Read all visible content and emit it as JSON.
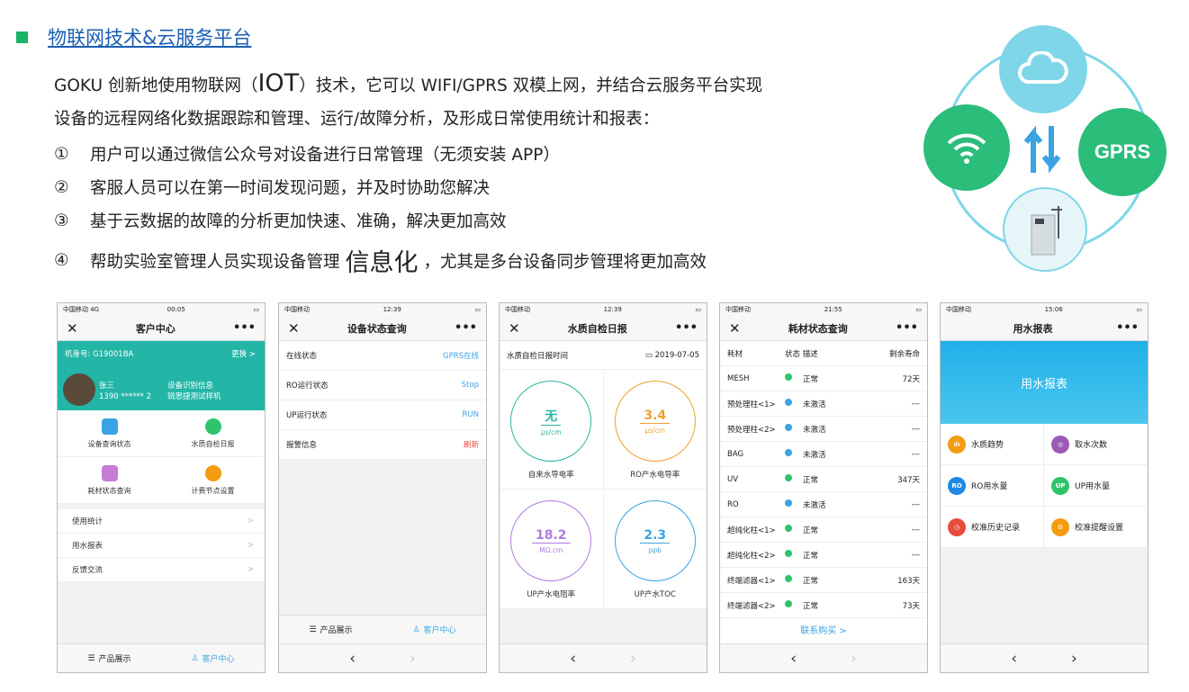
{
  "heading": "物联网技术&云服务平台",
  "intro": {
    "line1a": "GOKU 创新地使用物联网（",
    "iot": "IOT",
    "line1b": "）技术，它可以 WIFI/GPRS 双模上网，并结合云服务平台实现",
    "line2": "设备的远程网络化数据跟踪和管理、运行/故障分析，及形成日常使用统计和报表："
  },
  "items": [
    {
      "num": "①",
      "text": "用户可以通过微信公众号对设备进行日常管理（无须安装 APP）"
    },
    {
      "num": "②",
      "text": "客服人员可以在第一时间发现问题，并及时协助您解决"
    },
    {
      "num": "③",
      "text": "基于云数据的故障的分析更加快速、准确，解决更加高效"
    },
    {
      "num": "④",
      "text_a": "帮助实验室管理人员实现设备管理",
      "big": "信息化",
      "text_b": "，尤其是多台设备同步管理将更加高效"
    }
  ],
  "diagram": {
    "gprs": "GPRS"
  },
  "phone1": {
    "status_left": "中国移动 4G",
    "time": "00:05",
    "title": "客户中心",
    "machine": "机身号: G19001BA",
    "change": "更换 >",
    "name": "张三",
    "phone": "1390 ****** 2",
    "info1": "设备识别信息",
    "info2": "锐思捷测试样机",
    "grid": [
      "设备查询状态",
      "水质自检日报",
      "耗材状态查询",
      "计费节点设置"
    ],
    "list": [
      "使用统计",
      "用水报表",
      "反馈交流"
    ],
    "tab1": "产品展示",
    "tab2": "客户中心"
  },
  "phone2": {
    "status_left": "中国移动",
    "time": "12:39",
    "title": "设备状态查询",
    "rows": [
      {
        "k": "在线状态",
        "v": "GPRS在线"
      },
      {
        "k": "RO运行状态",
        "v": "Stop"
      },
      {
        "k": "UP运行状态",
        "v": "RUN"
      },
      {
        "k": "报警信息",
        "v": "刷新"
      }
    ],
    "tab1": "产品展示",
    "tab2": "客户中心"
  },
  "phone3": {
    "status_left": "中国移动",
    "time": "12:39",
    "title": "水质自检日报",
    "label": "水质自检日报时间",
    "date": "2019-07-05",
    "gauges": [
      {
        "v": "无",
        "u": "μs/cm",
        "l": "自来水导电率",
        "c": "#2bb5a3"
      },
      {
        "v": "3.4",
        "u": "μs/cm",
        "l": "RO产水电导率",
        "c": "#f0a030"
      },
      {
        "v": "18.2",
        "u": "MΩ.cm",
        "l": "UP产水电阻率",
        "c": "#b27be0"
      },
      {
        "v": "2.3",
        "u": "ppb",
        "l": "UP产水TOC",
        "c": "#3aa3e3"
      }
    ]
  },
  "phone4": {
    "status_left": "中国移动",
    "time": "21:55",
    "title": "耗材状态查询",
    "head": {
      "a": "耗材",
      "b": "状态",
      "c": "描述",
      "d": "剩余寿命"
    },
    "rows": [
      {
        "a": "MESH",
        "s": "#2ec46c",
        "c": "正常",
        "d": "72天"
      },
      {
        "a": "预处理柱<1>",
        "s": "#3aa3e3",
        "c": "未激活",
        "d": "---"
      },
      {
        "a": "预处理柱<2>",
        "s": "#3aa3e3",
        "c": "未激活",
        "d": "---"
      },
      {
        "a": "BAG",
        "s": "#3aa3e3",
        "c": "未激活",
        "d": "---"
      },
      {
        "a": "UV",
        "s": "#2ec46c",
        "c": "正常",
        "d": "347天"
      },
      {
        "a": "RO",
        "s": "#3aa3e3",
        "c": "未激活",
        "d": "---"
      },
      {
        "a": "超纯化柱<1>",
        "s": "#2ec46c",
        "c": "正常",
        "d": "---"
      },
      {
        "a": "超纯化柱<2>",
        "s": "#2ec46c",
        "c": "正常",
        "d": "---"
      },
      {
        "a": "终端滤器<1>",
        "s": "#2ec46c",
        "c": "正常",
        "d": "163天"
      },
      {
        "a": "终端滤器<2>",
        "s": "#2ec46c",
        "c": "正常",
        "d": "73天"
      }
    ],
    "buy": "联系购买 >"
  },
  "phone5": {
    "status_left": "中国移动",
    "time": "15:06",
    "title": "用水报表",
    "banner": "用水报表",
    "items": [
      {
        "l": "水质趋势",
        "c": "#f39c12",
        "i": "ılı"
      },
      {
        "l": "取水次数",
        "c": "#9b59b6",
        "i": "◎"
      },
      {
        "l": "RO用水量",
        "c": "#1e88e5",
        "i": "RO"
      },
      {
        "l": "UP用水量",
        "c": "#2ec46c",
        "i": "UP"
      },
      {
        "l": "校准历史记录",
        "c": "#e74c3c",
        "i": "◷"
      },
      {
        "l": "校准提醒设置",
        "c": "#f39c12",
        "i": "⚙"
      }
    ]
  },
  "nav": {
    "close": "✕",
    "more": "•••",
    "back": "‹",
    "fwd": "›"
  }
}
